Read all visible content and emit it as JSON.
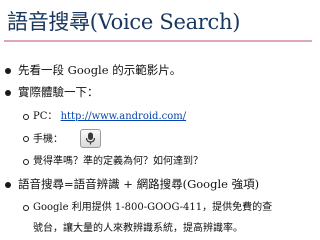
{
  "slide": {
    "title": "語音搜尋(Voice Search)",
    "bullets": [
      {
        "text": "先看一段 Google 的示範影片。"
      },
      {
        "text": "實際體驗一下："
      },
      {
        "text": "語音搜尋=語音辨識 + 網路搜尋(Google 強項)"
      }
    ],
    "subitems": [
      {
        "label": "PC：",
        "link": "http://www.android.com/"
      },
      {
        "label": "手機："
      },
      {
        "text": "覺得準嗎？準的定義為何？如何達到？"
      },
      {
        "text": "Google 利用提供 1-800-GOOG-411，提供免費的查"
      },
      {
        "text": "號台，讓大量的人來教辨識系統，提高辨識率。"
      }
    ]
  }
}
